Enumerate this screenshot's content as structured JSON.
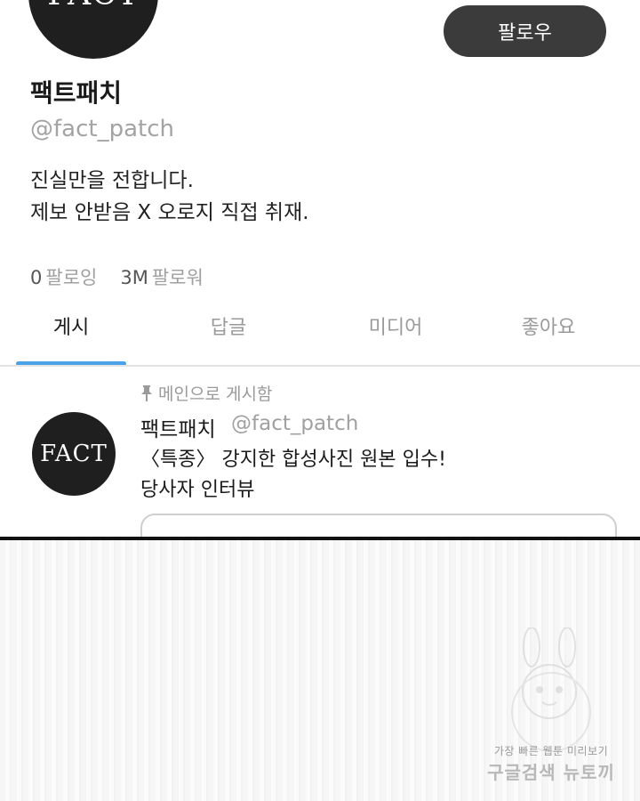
{
  "profile": {
    "avatar_text": "FACT",
    "follow_button_label": "팔로우",
    "display_name": "팩트패치",
    "handle": "@fact_patch",
    "bio_lines": [
      "진실만을 전합니다.",
      "제보 안받음 X 오로지 직접 취재."
    ]
  },
  "stats": {
    "following_count": "0",
    "following_label": "팔로잉",
    "followers_count": "3M",
    "followers_label": "팔로워"
  },
  "tabs": [
    {
      "label": "게시",
      "active": true
    },
    {
      "label": "답글",
      "active": false
    },
    {
      "label": "미디어",
      "active": false
    },
    {
      "label": "좋아요",
      "active": false
    }
  ],
  "accent_color": "#4aa3e8",
  "post": {
    "pinned_label": "메인으로 게시함",
    "avatar_text": "FACT",
    "author": "팩트패치",
    "handle": "@fact_patch",
    "text_lines": [
      "〈특종〉 강지한 합성사진 원본 입수!",
      "당사자 인터뷰"
    ]
  },
  "watermark": {
    "line1": "가장 빠른 웹툰 미리보기",
    "line2": "구글검색 뉴토끼"
  }
}
